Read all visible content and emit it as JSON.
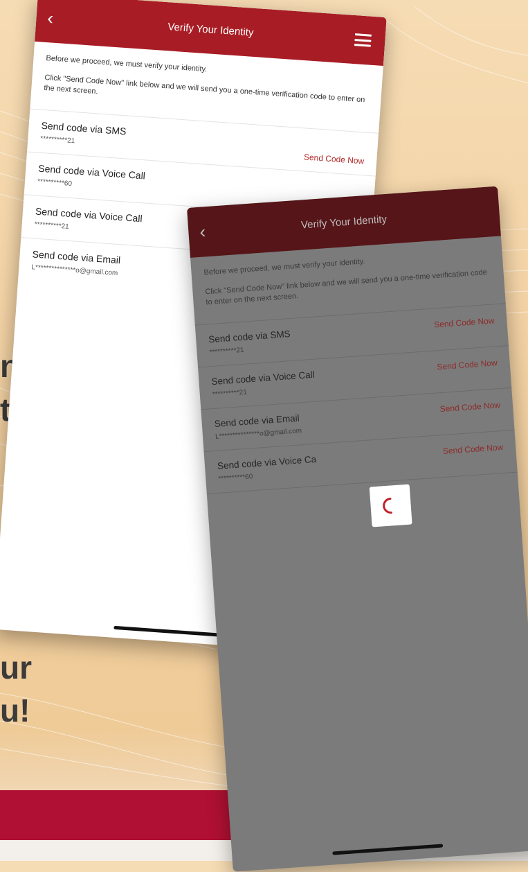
{
  "background": {
    "text_fragments": [
      "n",
      "t",
      "ur",
      "u!"
    ],
    "band_color": "#b01033"
  },
  "back_screen": {
    "title": "Verify Your Identity",
    "intro_line1": "Before we proceed, we must verify your identity.",
    "intro_line2": "Click \"Send Code Now\" link below and we will send you a one-time verification code to enter on the next screen.",
    "options": [
      {
        "label": "Send code via SMS",
        "masked": "**********21",
        "action": "Send Code Now"
      },
      {
        "label": "Send code via Voice Call",
        "masked": "**********60",
        "action": ""
      },
      {
        "label": "Send code via Voice Call",
        "masked": "**********21",
        "action": ""
      },
      {
        "label": "Send code via Email",
        "masked": "L***************o@gmail.com",
        "action": ""
      }
    ]
  },
  "front_screen": {
    "title": "Verify Your Identity",
    "intro_line1": "Before we proceed, we must verify your identity.",
    "intro_line2": "Click \"Send Code Now\" link below and we will send you a one-time verification code to enter on the next screen.",
    "options": [
      {
        "label": "Send code via SMS",
        "masked": "**********21",
        "action": "Send Code Now"
      },
      {
        "label": "Send code via Voice Call",
        "masked": "**********21",
        "action": "Send Code Now"
      },
      {
        "label": "Send code via Email",
        "masked": "L***************o@gmail.com",
        "action": "Send Code Now"
      },
      {
        "label": "Send code via Voice Ca",
        "masked": "**********60",
        "action": "Send Code Now"
      }
    ],
    "loading_indicator": "spinner"
  },
  "colors": {
    "header_active": "#a81d25",
    "header_dimmed": "#561518",
    "link_red": "#b22a2a",
    "overlay_gray": "#7b7b7b"
  }
}
